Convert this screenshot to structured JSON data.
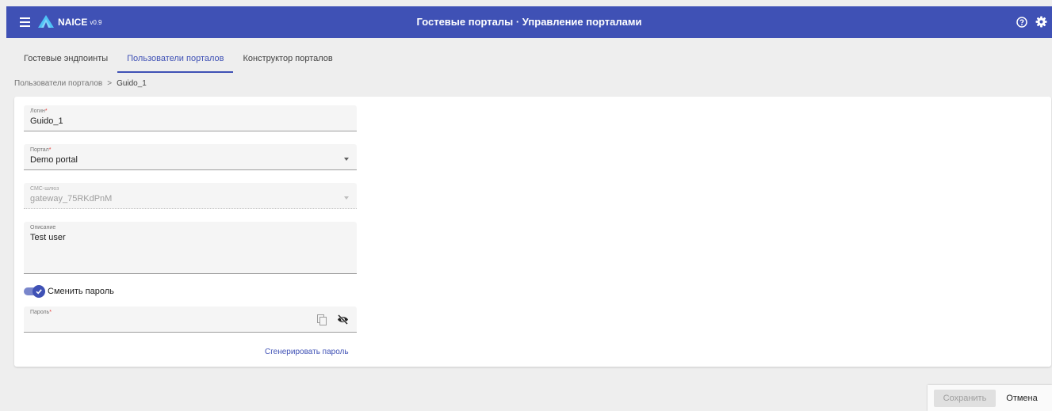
{
  "app": {
    "name": "NAICE",
    "version": "v0.9",
    "title": "Гостевые порталы · Управление порталами"
  },
  "icons": {
    "menu": "menu-icon",
    "logo": "naice-logo-icon",
    "help": "help-icon",
    "settings": "gear-icon",
    "copy": "copy-icon",
    "visibility": "eye-off-icon",
    "dropdown": "caret-down-icon",
    "check": "check-icon"
  },
  "tabs": [
    {
      "label": "Гостевые эндпоинты",
      "active": false
    },
    {
      "label": "Пользователи порталов",
      "active": true
    },
    {
      "label": "Конструктор порталов",
      "active": false
    }
  ],
  "breadcrumb": {
    "parent": "Пользователи порталов",
    "separator": ">",
    "current": "Guido_1"
  },
  "form": {
    "login": {
      "label": "Логин",
      "required_mark": "*",
      "value": "Guido_1"
    },
    "portal": {
      "label": "Портал",
      "required_mark": "*",
      "value": "Demo portal"
    },
    "sms_gateway": {
      "label": "СМС-шлюз",
      "value": "gateway_75RKdPnM",
      "disabled": true
    },
    "description": {
      "label": "Описание",
      "value": "Test user"
    },
    "change_password": {
      "label": "Сменить пароль",
      "checked": true
    },
    "password": {
      "label": "Пароль",
      "required_mark": "*",
      "value": ""
    },
    "generate_link": "Сгенерировать пароль"
  },
  "actions": {
    "save": "Сохранить",
    "cancel": "Отмена"
  },
  "colors": {
    "primary": "#3f51b5",
    "background": "#eeeeee",
    "required": "#e53935"
  }
}
